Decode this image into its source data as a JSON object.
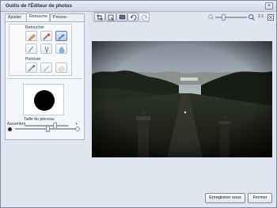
{
  "window": {
    "title": "Outils de l'Éditeur de photos",
    "close_glyph": "×"
  },
  "tabs": [
    {
      "label": "Ajuster"
    },
    {
      "label": "Retouche"
    },
    {
      "label": "Presse-papiers"
    }
  ],
  "retoucher": {
    "label": "Retoucher",
    "tools": [
      "pencil-eraser-icon",
      "brush-icon",
      "wand-icon",
      "bandage-icon",
      "tweezers-icon",
      "drop-icon"
    ]
  },
  "peinture": {
    "label": "Peinture",
    "tools": [
      "paint-brush-icon",
      "pen-icon",
      "eraser-icon"
    ]
  },
  "brush_color": "#000000",
  "brush_size": {
    "label": "Taille du pinceau",
    "level": 0.7
  },
  "soften": {
    "label": "Assombrir",
    "plus": "+",
    "level": 0.55
  },
  "toolbar": {
    "icons": [
      "crop-icon",
      "resize-icon",
      "monitor-icon",
      "undo-icon",
      "redo-icon"
    ]
  },
  "zoom": {
    "ratio_label": "1:1",
    "level": 0.25
  },
  "buttons": {
    "save_as": "Enregistrer sous",
    "close": "Fermer"
  },
  "colors": {
    "accent": "#5b7fb6",
    "window_bg": "#dfe6ef"
  }
}
